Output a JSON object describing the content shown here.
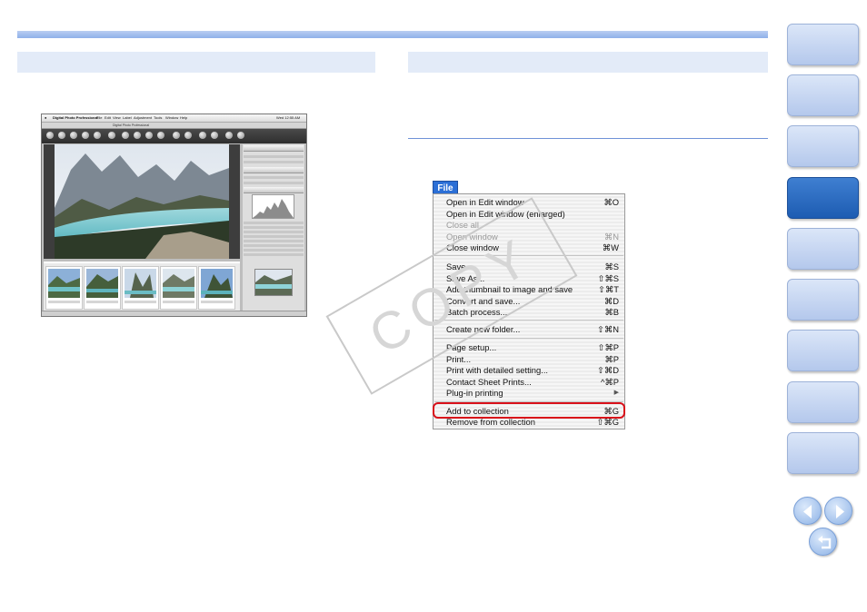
{
  "dpp": {
    "app_name": "Digital Photo Professional",
    "menus": [
      "File",
      "Edit",
      "View",
      "Label",
      "Adjustment",
      "Tools",
      "Window",
      "Help"
    ],
    "clock": "Wed 12:55 AM",
    "window_title": "Digital Photo Professional"
  },
  "file_menu": {
    "title": "File",
    "items": [
      {
        "label": "Open in Edit window",
        "shortcut": "⌘O",
        "enabled": true
      },
      {
        "label": "Open in Edit window (enlarged)",
        "shortcut": "",
        "enabled": true
      },
      {
        "label": "Close all",
        "shortcut": "",
        "enabled": false
      },
      {
        "label": "Open window",
        "shortcut": "⌘N",
        "enabled": false
      },
      {
        "label": "Close window",
        "shortcut": "⌘W",
        "enabled": true
      },
      {
        "label": "Save",
        "shortcut": "⌘S",
        "enabled": true
      },
      {
        "label": "Save As...",
        "shortcut": "⇧⌘S",
        "enabled": true
      },
      {
        "label": "Add thumbnail to image and save",
        "shortcut": "⇧⌘T",
        "enabled": true
      },
      {
        "label": "Convert and save...",
        "shortcut": "⌘D",
        "enabled": true
      },
      {
        "label": "Batch process...",
        "shortcut": "⌘B",
        "enabled": true
      },
      {
        "label": "Create new folder...",
        "shortcut": "⇧⌘N",
        "enabled": true
      },
      {
        "label": "Page setup...",
        "shortcut": "⇧⌘P",
        "enabled": true
      },
      {
        "label": "Print...",
        "shortcut": "⌘P",
        "enabled": true
      },
      {
        "label": "Print with detailed setting...",
        "shortcut": "⇧⌘D",
        "enabled": true
      },
      {
        "label": "Contact Sheet Prints...",
        "shortcut": "^⌘P",
        "enabled": true
      },
      {
        "label": "Plug-in printing",
        "shortcut": "▶",
        "enabled": true
      },
      {
        "label": "Add to collection",
        "shortcut": "⌘G",
        "enabled": true,
        "highlighted": true
      },
      {
        "label": "Remove from collection",
        "shortcut": "⇧⌘G",
        "enabled": true
      }
    ]
  },
  "watermark": "COPY",
  "nav": {
    "tab_count": 9,
    "active_index": 3,
    "colors": {
      "tab": "#c4d4f1",
      "active": "#2a69c0",
      "accent": "#d9101a"
    },
    "buttons": [
      "previous-page",
      "next-page",
      "return"
    ]
  }
}
